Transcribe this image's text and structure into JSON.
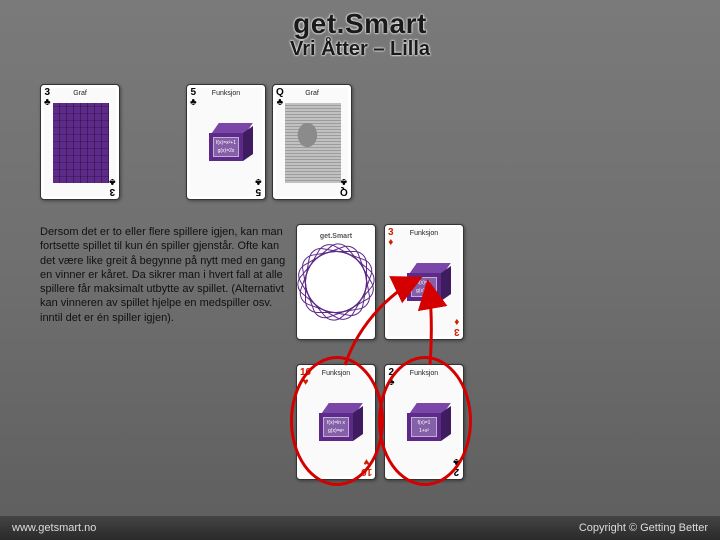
{
  "header": {
    "title": "get.Smart",
    "subtitle": "Vri Åtter – Lilla"
  },
  "body_text": "Dersom det er to eller flere spillere igjen, kan man fortsette spillet til kun én spiller gjenstår. Ofte kan det være like greit å begynne på nytt med en gang en vinner er kåret. Da sikrer man i hvert fall at alle spillere får maksimalt utbytte av spillet. (Alternativt kan vinneren av spillet hjelpe en medspiller osv. inntil det er én spiller igjen).",
  "cards": {
    "row1": [
      {
        "rank": "3",
        "suit": "♣",
        "suit_name": "clubs",
        "label": "Graf",
        "kind": "graf"
      },
      {
        "rank": "5",
        "suit": "♣",
        "suit_name": "clubs",
        "label": "Funksjon",
        "kind": "func",
        "panel": [
          "f(x)=x²+1",
          "g(x)=2x"
        ]
      },
      {
        "rank": "Q",
        "suit": "♣",
        "suit_name": "clubs",
        "label": "Graf",
        "kind": "portrait"
      }
    ],
    "row2": [
      {
        "kind": "back",
        "brand": "get.Smart"
      },
      {
        "rank": "3",
        "suit": "♦",
        "suit_name": "diamonds",
        "label": "Funksjon",
        "kind": "func",
        "panel": [
          "f(x)=x",
          "g(x)=x²"
        ]
      }
    ],
    "row3": [
      {
        "rank": "10",
        "suit": "♥",
        "suit_name": "hearts",
        "label": "Funksjon",
        "kind": "func",
        "panel": [
          "f(x)=ln x",
          "g(x)=eˣ"
        ]
      },
      {
        "rank": "2",
        "suit": "♣",
        "suit_name": "clubs",
        "label": "Funksjon",
        "kind": "func",
        "panel": [
          "f(x)=1",
          "1+x²"
        ]
      }
    ]
  },
  "footer": {
    "left": "www.getsmart.no",
    "right": "Copyright © Getting Better"
  }
}
